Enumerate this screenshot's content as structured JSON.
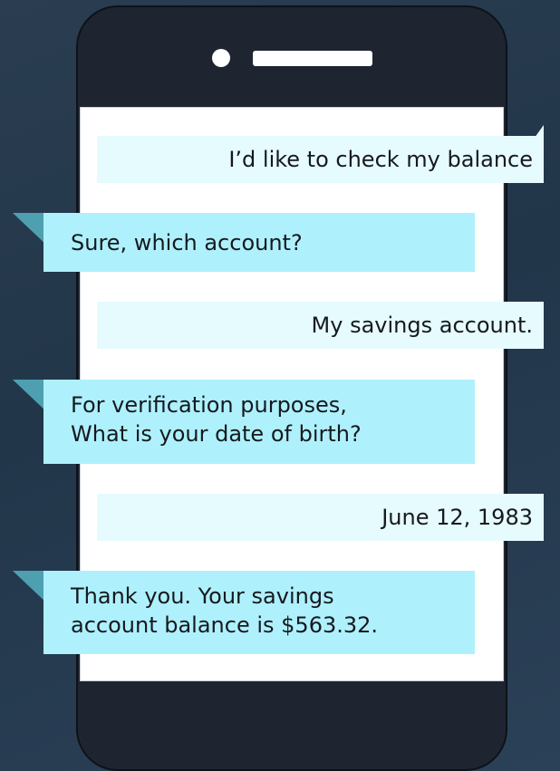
{
  "phone": {
    "camera_icon": "camera-dot-icon",
    "speaker_icon": "speaker-grille-icon"
  },
  "colors": {
    "background": "#22364a",
    "phone_body": "#1e2531",
    "screen": "#ffffff",
    "user_bubble": "#e6fbfd",
    "bot_bubble": "#aef1fc",
    "text": "#16191f"
  },
  "conversation": {
    "messages": [
      {
        "sender": "user",
        "lines": [
          "I’d like to check my balance"
        ]
      },
      {
        "sender": "bot",
        "lines": [
          "Sure, which account?"
        ]
      },
      {
        "sender": "user",
        "lines": [
          "My savings account."
        ]
      },
      {
        "sender": "bot",
        "lines": [
          "For verification purposes,",
          "What is your date of birth?"
        ]
      },
      {
        "sender": "user",
        "lines": [
          "June 12, 1983"
        ]
      },
      {
        "sender": "bot",
        "lines": [
          "Thank you. Your savings",
          "account balance is $563.32."
        ]
      }
    ]
  }
}
